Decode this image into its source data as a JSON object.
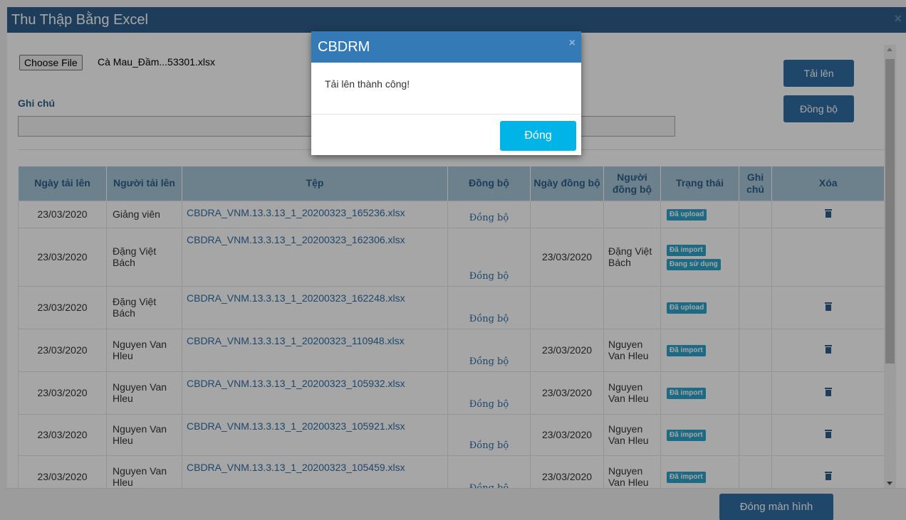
{
  "window": {
    "title": "Thu Thập Bằng Excel",
    "close": "×"
  },
  "form": {
    "choose_file": "Choose File",
    "file_name": "Cà Mau_Đầm...53301.xlsx",
    "note_label": "Ghi chú",
    "note_value": ""
  },
  "buttons": {
    "upload": "Tải lên",
    "sync": "Đồng bộ",
    "close_screen": "Đóng màn hình"
  },
  "table": {
    "headers": [
      "Ngày tải lên",
      "Người tải lên",
      "Tệp",
      "Đồng bộ",
      "Ngày đồng bộ",
      "Người đồng bộ",
      "Trạng thái",
      "Ghi chú",
      "Xóa"
    ],
    "rows": [
      {
        "date": "23/03/2020",
        "user": "Giảng viên",
        "file": "CBDRA_VNM.13.3.13_1_20200323_165236.xlsx",
        "sync": "Đồng bộ",
        "sync_date": "",
        "sync_user": "",
        "status": [
          "Đã upload"
        ],
        "note": "",
        "delete": true
      },
      {
        "date": "23/03/2020",
        "user": "Đặng Việt Bách",
        "file": "CBDRA_VNM.13.3.13_1_20200323_162306.xlsx",
        "sync": "Đồng bộ",
        "sync_date": "23/03/2020",
        "sync_user": "Đặng Việt Bách",
        "status": [
          "Đã import",
          "Đang sử dụng"
        ],
        "note": "",
        "delete": false
      },
      {
        "date": "23/03/2020",
        "user": "Đặng Việt Bách",
        "file": "CBDRA_VNM.13.3.13_1_20200323_162248.xlsx",
        "sync": "Đồng bộ",
        "sync_date": "",
        "sync_user": "",
        "status": [
          "Đã upload"
        ],
        "note": "",
        "delete": true
      },
      {
        "date": "23/03/2020",
        "user": "Nguyen Van Hleu",
        "file": "CBDRA_VNM.13.3.13_1_20200323_110948.xlsx",
        "sync": "Đồng bộ",
        "sync_date": "23/03/2020",
        "sync_user": "Nguyen Van Hleu",
        "status": [
          "Đã import"
        ],
        "note": "",
        "delete": true
      },
      {
        "date": "23/03/2020",
        "user": "Nguyen Van Hleu",
        "file": "CBDRA_VNM.13.3.13_1_20200323_105932.xlsx",
        "sync": "Đồng bộ",
        "sync_date": "23/03/2020",
        "sync_user": "Nguyen Van Hleu",
        "status": [
          "Đã import"
        ],
        "note": "",
        "delete": true
      },
      {
        "date": "23/03/2020",
        "user": "Nguyen Van Hleu",
        "file": "CBDRA_VNM.13.3.13_1_20200323_105921.xlsx",
        "sync": "Đồng bộ",
        "sync_date": "23/03/2020",
        "sync_user": "Nguyen Van Hleu",
        "status": [
          "Đã import"
        ],
        "note": "",
        "delete": true
      },
      {
        "date": "23/03/2020",
        "user": "Nguyen Van Hleu",
        "file": "CBDRA_VNM.13.3.13_1_20200323_105459.xlsx",
        "sync": "Đồng bộ",
        "sync_date": "23/03/2020",
        "sync_user": "Nguyen Van Hleu",
        "status": [
          "Đã import"
        ],
        "note": "",
        "delete": true
      }
    ]
  },
  "modal": {
    "title": "CBDRM",
    "message": "Tải lên thành công!",
    "close_x": "×",
    "ok": "Đóng"
  },
  "colors": {
    "header": "#2e5f8a",
    "table_header": "#a8c6d7",
    "badge": "#2ba3c9",
    "modal_header": "#337ab7",
    "ok_button": "#00b4e8"
  }
}
